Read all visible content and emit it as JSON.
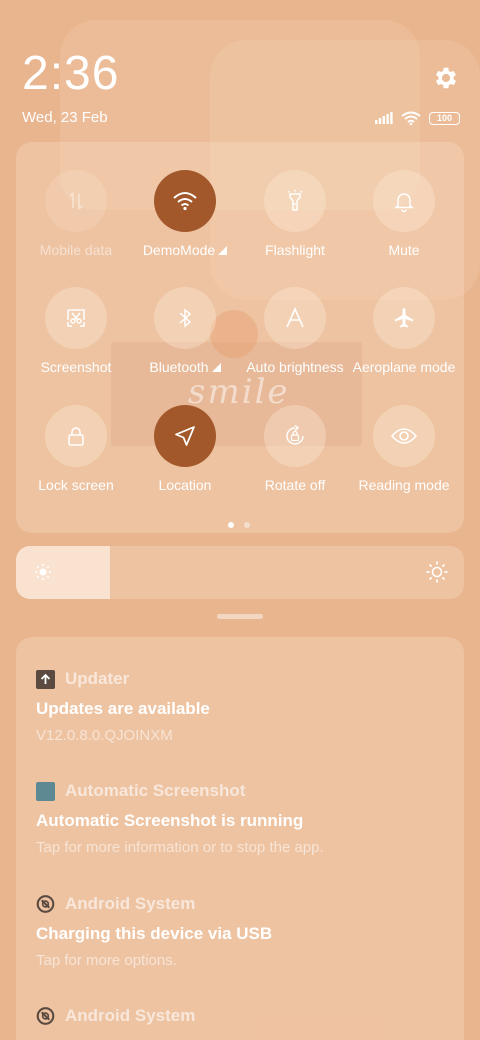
{
  "status_bar": {
    "time": "2:36",
    "date": "Wed, 23 Feb",
    "battery_level": "100",
    "icons": [
      "signal-icon",
      "wifi-icon",
      "battery-icon"
    ]
  },
  "header": {
    "settings_icon": "gear-icon"
  },
  "quick_settings": {
    "tiles": [
      {
        "label": "Mobile data",
        "icon": "mobile-data-icon",
        "state": "disabled"
      },
      {
        "label": "DemoMode",
        "icon": "wifi-icon",
        "state": "active",
        "has_arrow": true
      },
      {
        "label": "Flashlight",
        "icon": "flashlight-icon",
        "state": "off"
      },
      {
        "label": "Mute",
        "icon": "bell-icon",
        "state": "off"
      },
      {
        "label": "Screenshot",
        "icon": "screenshot-icon",
        "state": "off"
      },
      {
        "label": "Bluetooth",
        "icon": "bluetooth-icon",
        "state": "off",
        "has_arrow": true
      },
      {
        "label": "Auto brightness",
        "icon": "auto-brightness-icon",
        "state": "off"
      },
      {
        "label": "Aeroplane mode",
        "icon": "airplane-icon",
        "state": "off"
      },
      {
        "label": "Lock screen",
        "icon": "lock-icon",
        "state": "off"
      },
      {
        "label": "Location",
        "icon": "location-icon",
        "state": "active"
      },
      {
        "label": "Rotate off",
        "icon": "rotate-lock-icon",
        "state": "off"
      },
      {
        "label": "Reading mode",
        "icon": "eye-icon",
        "state": "off"
      }
    ],
    "page_count": 2,
    "current_page": 1
  },
  "wallpaper": {
    "smile_text": "smile"
  },
  "brightness": {
    "level": 0.21
  },
  "notifications": [
    {
      "app": "Updater",
      "icon": "updater-icon",
      "title": "Updates are available",
      "text": "V12.0.8.0.QJOINXM"
    },
    {
      "app": "Automatic Screenshot",
      "icon": "screenshot-app-icon",
      "title": "Automatic Screenshot is running",
      "text": "Tap for more information or to stop the app."
    },
    {
      "app": "Android System",
      "icon": "android-system-icon",
      "title": "Charging this device via USB",
      "text": "Tap for more options."
    },
    {
      "app": "Android System",
      "icon": "android-system-icon",
      "title": "",
      "text": ""
    }
  ],
  "colors": {
    "background": "#e9b58f",
    "active_tile": "#a2582a"
  }
}
